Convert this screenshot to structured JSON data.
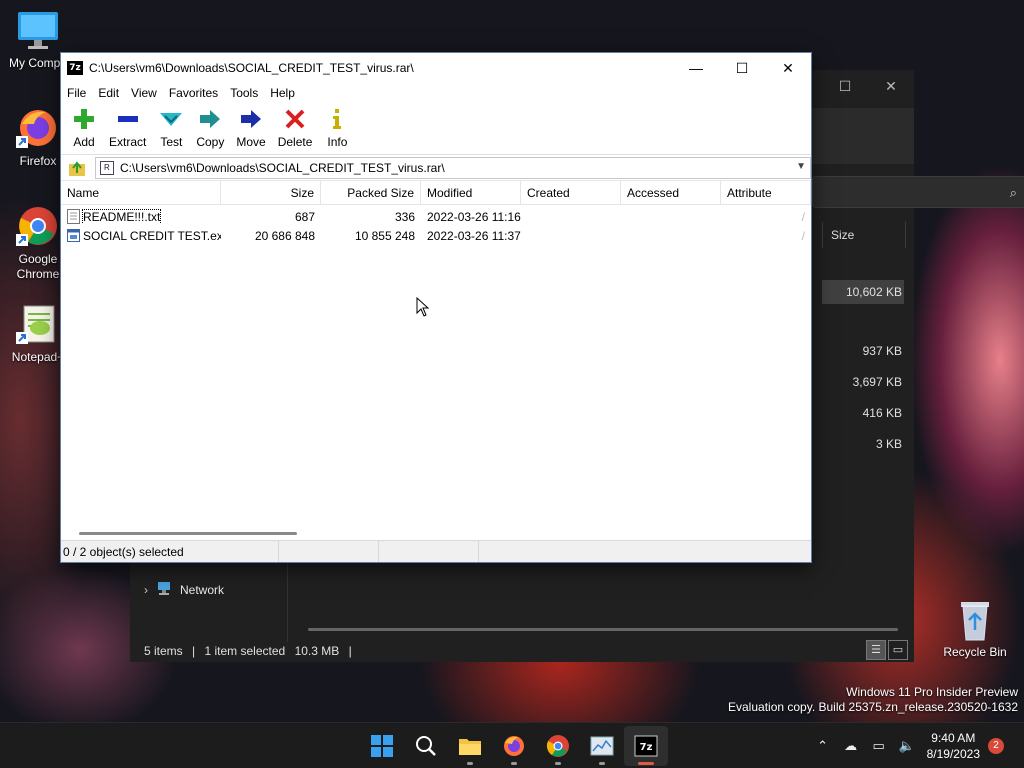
{
  "desktop": {
    "icons": [
      {
        "label": "My Compu",
        "icon": "computer-icon"
      },
      {
        "label": "Firefox",
        "icon": "firefox-icon"
      },
      {
        "label": "Google Chrome",
        "icon": "chrome-icon"
      },
      {
        "label": "Notepad+",
        "icon": "notepadpp-icon"
      }
    ],
    "recycle_bin": "Recycle Bin",
    "watermark_line1": "Windows 11 Pro Insider Preview",
    "watermark_line2": "Evaluation copy. Build 25375.zn_release.230520-1632"
  },
  "explorer": {
    "size_header": "Size",
    "sizes": [
      "10,602 KB",
      "937 KB",
      "3,697 KB",
      "416 KB",
      "3 KB"
    ],
    "nav_network": "Network",
    "status_items": "5 items",
    "status_selected": "1 item selected",
    "status_size": "10.3 MB",
    "status_sep": "|"
  },
  "zip": {
    "title": "C:\\Users\\vm6\\Downloads\\SOCIAL_CREDIT_TEST_virus.rar\\",
    "app_icon_text": "7z",
    "menu": [
      "File",
      "Edit",
      "View",
      "Favorites",
      "Tools",
      "Help"
    ],
    "toolbar": [
      {
        "label": "Add",
        "icon": "add-icon",
        "color": "#2fa82f"
      },
      {
        "label": "Extract",
        "icon": "extract-icon",
        "color": "#1a2fbf"
      },
      {
        "label": "Test",
        "icon": "test-icon",
        "color": "#27b7c9"
      },
      {
        "label": "Copy",
        "icon": "copy-icon",
        "color": "#1f8f8f"
      },
      {
        "label": "Move",
        "icon": "move-icon",
        "color": "#1a2fa8"
      },
      {
        "label": "Delete",
        "icon": "delete-icon",
        "color": "#d92020"
      },
      {
        "label": "Info",
        "icon": "info-icon",
        "color": "#c8b000"
      }
    ],
    "address": "C:\\Users\\vm6\\Downloads\\SOCIAL_CREDIT_TEST_virus.rar\\",
    "columns": [
      "Name",
      "Size",
      "Packed Size",
      "Modified",
      "Created",
      "Accessed",
      "Attribute"
    ],
    "files": [
      {
        "name": "README!!!.txt",
        "size": "687",
        "packed": "336",
        "modified": "2022-03-26 11:16",
        "created": "",
        "accessed": "",
        "attr": "/"
      },
      {
        "name": "SOCIAL CREDIT TEST.exe",
        "size": "20 686 848",
        "packed": "10 855 248",
        "modified": "2022-03-26 11:37",
        "created": "",
        "accessed": "",
        "attr": "/"
      }
    ],
    "status": "0 / 2 object(s) selected"
  },
  "taskbar": {
    "apps": [
      "start-icon",
      "search-icon",
      "file-explorer-icon",
      "firefox-icon",
      "chrome-icon",
      "task-manager-icon",
      "7zip-icon"
    ],
    "time": "9:40 AM",
    "date": "8/19/2023",
    "notifications": "2"
  }
}
